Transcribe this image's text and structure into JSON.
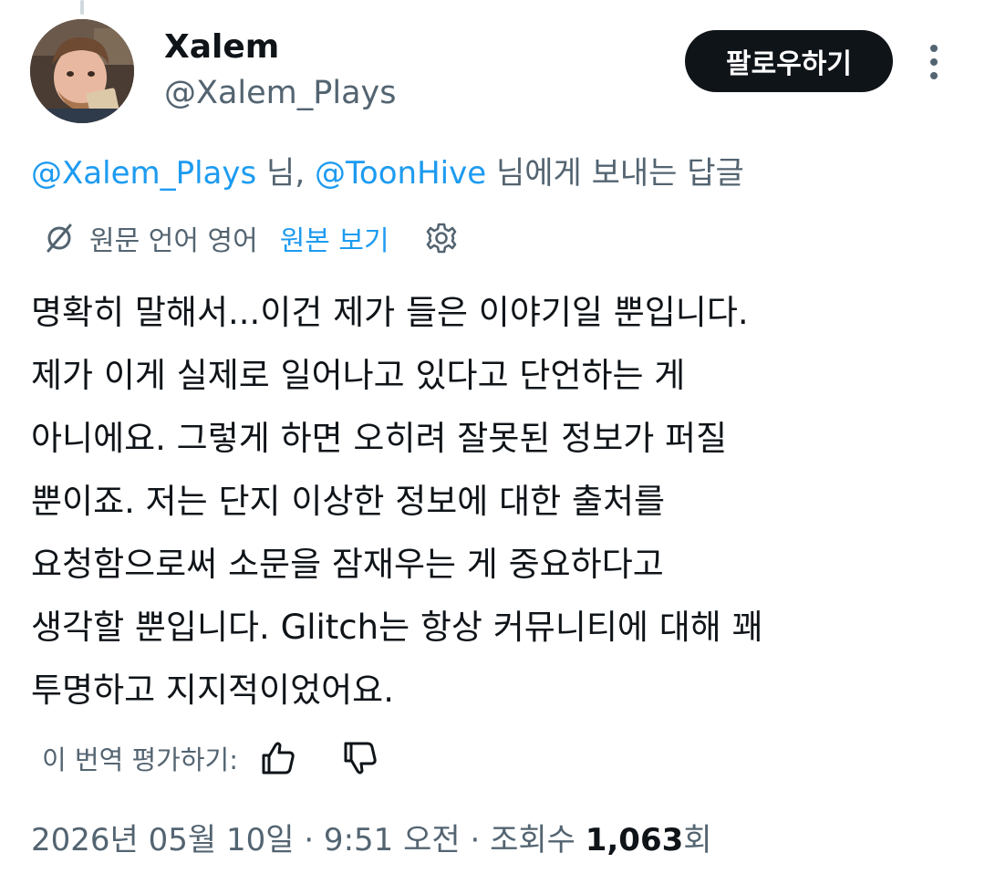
{
  "author": {
    "display_name": "Xalem",
    "handle": "@Xalem_Plays",
    "avatar_icon": "profile-photo"
  },
  "actions": {
    "follow_label": "팔로우하기",
    "more_icon": "more-vertical-icon"
  },
  "reply_context": {
    "mention_1": "@Xalem_Plays",
    "suffix_1": " 님, ",
    "mention_2": "@ToonHive",
    "suffix_2": " 님에게 보내는 답글"
  },
  "translation": {
    "icon": "translate-icon",
    "source_label": "원문 언어 영어",
    "show_original_label": "원본 보기",
    "settings_icon": "gear-icon"
  },
  "tweet": {
    "lines": [
      "명확히 말해서...이건 제가 들은 이야기일 뿐입니다.",
      "제가 이게 실제로 일어나고 있다고 단언하는 게",
      "아니에요. 그렇게 하면 오히려 잘못된 정보가 퍼질",
      "뿐이죠. 저는 단지 이상한 정보에 대한 출처를",
      "요청함으로써 소문을 잠재우는 게 중요하다고",
      "생각할 뿐입니다. Glitch는 항상 커뮤니티에 대해 꽤",
      "투명하고 지지적이었어요."
    ]
  },
  "rating": {
    "label": "이 번역 평가하기:",
    "thumbs_up_icon": "thumbs-up-icon",
    "thumbs_down_icon": "thumbs-down-icon"
  },
  "meta": {
    "timestamp": "2026년 05월 10일 · 9:51 오전 · 조회수 ",
    "views_count": "1,063",
    "views_suffix": "회"
  },
  "colors": {
    "text_primary": "#0f1419",
    "text_secondary": "#536471",
    "link_blue": "#1d9bf0",
    "button_black": "#0f1419"
  }
}
